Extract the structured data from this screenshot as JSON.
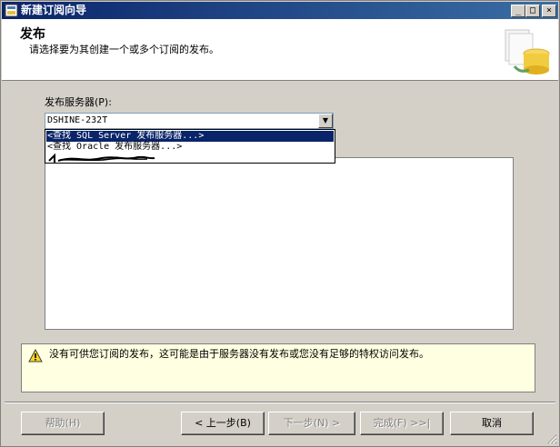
{
  "window": {
    "title": "新建订阅向导"
  },
  "header": {
    "title": "发布",
    "subtitle": "请选择要为其创建一个或多个订阅的发布。"
  },
  "publisher": {
    "label": "发布服务器(P):",
    "selected": "DSHINE-232T",
    "options": [
      "<查找 SQL Server 发布服务器...>",
      "<查找 Oracle 发布服务器...>"
    ]
  },
  "warning": {
    "text": "没有可供您订阅的发布，这可能是由于服务器没有发布或您没有足够的特权访问发布。"
  },
  "buttons": {
    "help": "帮助(H)",
    "back": "< 上一步(B)",
    "next": "下一步(N) >",
    "finish": "完成(F) >>|",
    "cancel": "取消"
  },
  "title_buttons": {
    "minimize": "_",
    "maximize": "□",
    "close": "×"
  },
  "colors": {
    "titlebar_start": "#0a246a",
    "titlebar_end": "#3a6ea5",
    "selection": "#0a246a",
    "warning_bg": "#ffffe1"
  }
}
